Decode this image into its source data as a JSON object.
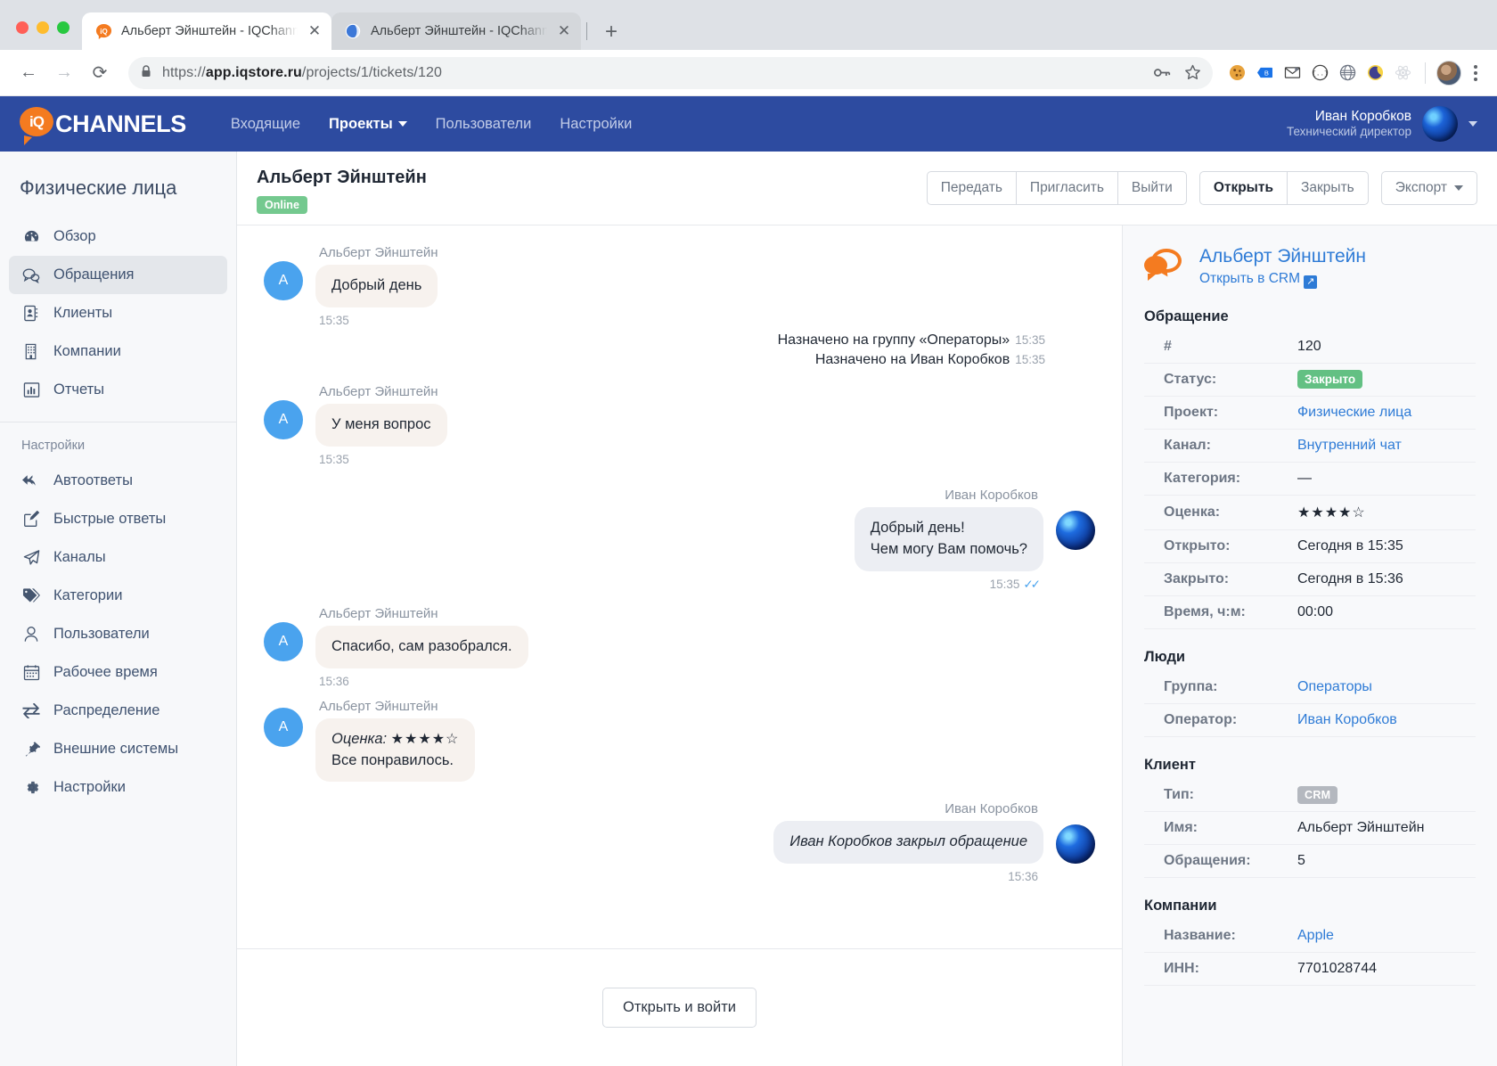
{
  "browser": {
    "tabs": [
      {
        "title": "Альберт Эйнштейн - IQChann",
        "favicon": "iqchannels-icon",
        "close": "✕",
        "active": true
      },
      {
        "title": "Альберт Эйнштейн - IQChann",
        "favicon": "globe-icon",
        "close": "✕",
        "active": false
      }
    ],
    "new_tab": "+",
    "back": "←",
    "forward": "→",
    "reload": "⟳",
    "lock": "🔒",
    "url_prefix": "https://",
    "url_domain": "app.iqstore.ru",
    "url_path": "/projects/1/tickets/120",
    "omni_icons": [
      "key-icon",
      "star-icon"
    ],
    "extensions": [
      "cookie-icon",
      "tag-icon",
      "envelope-icon",
      "circle-icon",
      "globe-icon",
      "moon-icon",
      "react-icon"
    ],
    "menu": "kebab-menu-icon"
  },
  "appbar": {
    "brand_mark": "iQ",
    "brand_word": "CHANNELS",
    "nav": [
      {
        "label": "Входящие",
        "active": false,
        "caret": false
      },
      {
        "label": "Проекты",
        "active": true,
        "caret": true
      },
      {
        "label": "Пользователи",
        "active": false,
        "caret": false
      },
      {
        "label": "Настройки",
        "active": false,
        "caret": false
      }
    ],
    "user_name": "Иван Коробков",
    "user_role": "Технический директор"
  },
  "sidebar": {
    "title": "Физические лица",
    "items": [
      {
        "label": "Обзор",
        "icon": "dashboard-icon",
        "active": false
      },
      {
        "label": "Обращения",
        "icon": "chat-icon",
        "active": true
      },
      {
        "label": "Клиенты",
        "icon": "address-book-icon",
        "active": false
      },
      {
        "label": "Компании",
        "icon": "building-icon",
        "active": false
      },
      {
        "label": "Отчеты",
        "icon": "bar-chart-icon",
        "active": false
      }
    ],
    "group_label": "Настройки",
    "settings_items": [
      {
        "label": "Автоответы",
        "icon": "reply-all-icon"
      },
      {
        "label": "Быстрые ответы",
        "icon": "edit-square-icon"
      },
      {
        "label": "Каналы",
        "icon": "paper-plane-icon"
      },
      {
        "label": "Категории",
        "icon": "tags-icon"
      },
      {
        "label": "Пользователи",
        "icon": "user-icon"
      },
      {
        "label": "Рабочее время",
        "icon": "calendar-icon"
      },
      {
        "label": "Распределение",
        "icon": "exchange-icon"
      },
      {
        "label": "Внешние системы",
        "icon": "plug-icon"
      },
      {
        "label": "Настройки",
        "icon": "gear-icon"
      }
    ]
  },
  "ticket_header": {
    "title": "Альберт Эйнштейн",
    "status_badge": "Online",
    "buttons_group1": [
      "Передать",
      "Пригласить",
      "Выйти"
    ],
    "buttons_group2": [
      "Открыть",
      "Закрыть"
    ],
    "export_label": "Экспорт"
  },
  "chat": {
    "messages": [
      {
        "kind": "in",
        "avatar": "A",
        "sender": "Альберт Эйнштейн",
        "text": "Добрый день",
        "time": "15:35"
      },
      {
        "kind": "system",
        "text": "Назначено на группу «Операторы»",
        "time": "15:35"
      },
      {
        "kind": "system",
        "text": "Назначено на Иван Коробков",
        "time": "15:35"
      },
      {
        "kind": "in",
        "avatar": "A",
        "sender": "Альберт Эйнштейн",
        "text": "У меня вопрос",
        "time": "15:35"
      },
      {
        "kind": "out",
        "sender": "Иван Коробков",
        "line1": "Добрый день!",
        "line2": "Чем могу Вам помочь?",
        "time": "15:35",
        "read": "✓✓"
      },
      {
        "kind": "in",
        "avatar": "A",
        "sender": "Альберт Эйнштейн",
        "text": "Спасибо, сам разобрался.",
        "time": "15:36"
      },
      {
        "kind": "rating",
        "avatar": "A",
        "sender": "Альберт Эйнштейн",
        "label": "Оценка:",
        "stars": "★★★★☆",
        "comment": "Все понравилось.",
        "time": ""
      },
      {
        "kind": "out",
        "sender": "Иван Коробков",
        "text": "Иван Коробков закрыл обращение",
        "time": "15:36"
      }
    ],
    "footer_button": "Открыть и войти"
  },
  "info": {
    "client_name": "Альберт Эйнштейн",
    "crm_link": "Открыть в CRM",
    "sections": [
      {
        "title": "Обращение",
        "rows": [
          {
            "key": "#",
            "value": "120",
            "type": "text"
          },
          {
            "key": "Статус:",
            "value": "Закрыто",
            "type": "pill-green"
          },
          {
            "key": "Проект:",
            "value": "Физические лица",
            "type": "link"
          },
          {
            "key": "Канал:",
            "value": "Внутренний чат",
            "type": "link"
          },
          {
            "key": "Категория:",
            "value": "—",
            "type": "text"
          },
          {
            "key": "Оценка:",
            "value": "★★★★☆",
            "type": "stars"
          },
          {
            "key": "Открыто:",
            "value": "Сегодня в 15:35",
            "type": "text"
          },
          {
            "key": "Закрыто:",
            "value": "Сегодня в 15:36",
            "type": "text"
          },
          {
            "key": "Время, ч:м:",
            "value": "00:00",
            "type": "text"
          }
        ]
      },
      {
        "title": "Люди",
        "rows": [
          {
            "key": "Группа:",
            "value": "Операторы",
            "type": "link"
          },
          {
            "key": "Оператор:",
            "value": "Иван Коробков",
            "type": "link"
          }
        ]
      },
      {
        "title": "Клиент",
        "rows": [
          {
            "key": "Тип:",
            "value": "CRM",
            "type": "pill-grey"
          },
          {
            "key": "Имя:",
            "value": "Альберт Эйнштейн",
            "type": "text"
          },
          {
            "key": "Обращения:",
            "value": "5",
            "type": "text"
          }
        ]
      },
      {
        "title": "Компании",
        "rows": [
          {
            "key": "Название:",
            "value": "Apple",
            "type": "link"
          },
          {
            "key": "ИНН:",
            "value": "7701028744",
            "type": "text"
          }
        ]
      }
    ]
  },
  "colors": {
    "brand_blue": "#2d4ba0",
    "brand_orange": "#f47b20",
    "link": "#2e7bd6",
    "status_green": "#63c083",
    "client_avatar": "#4aa3ee"
  }
}
